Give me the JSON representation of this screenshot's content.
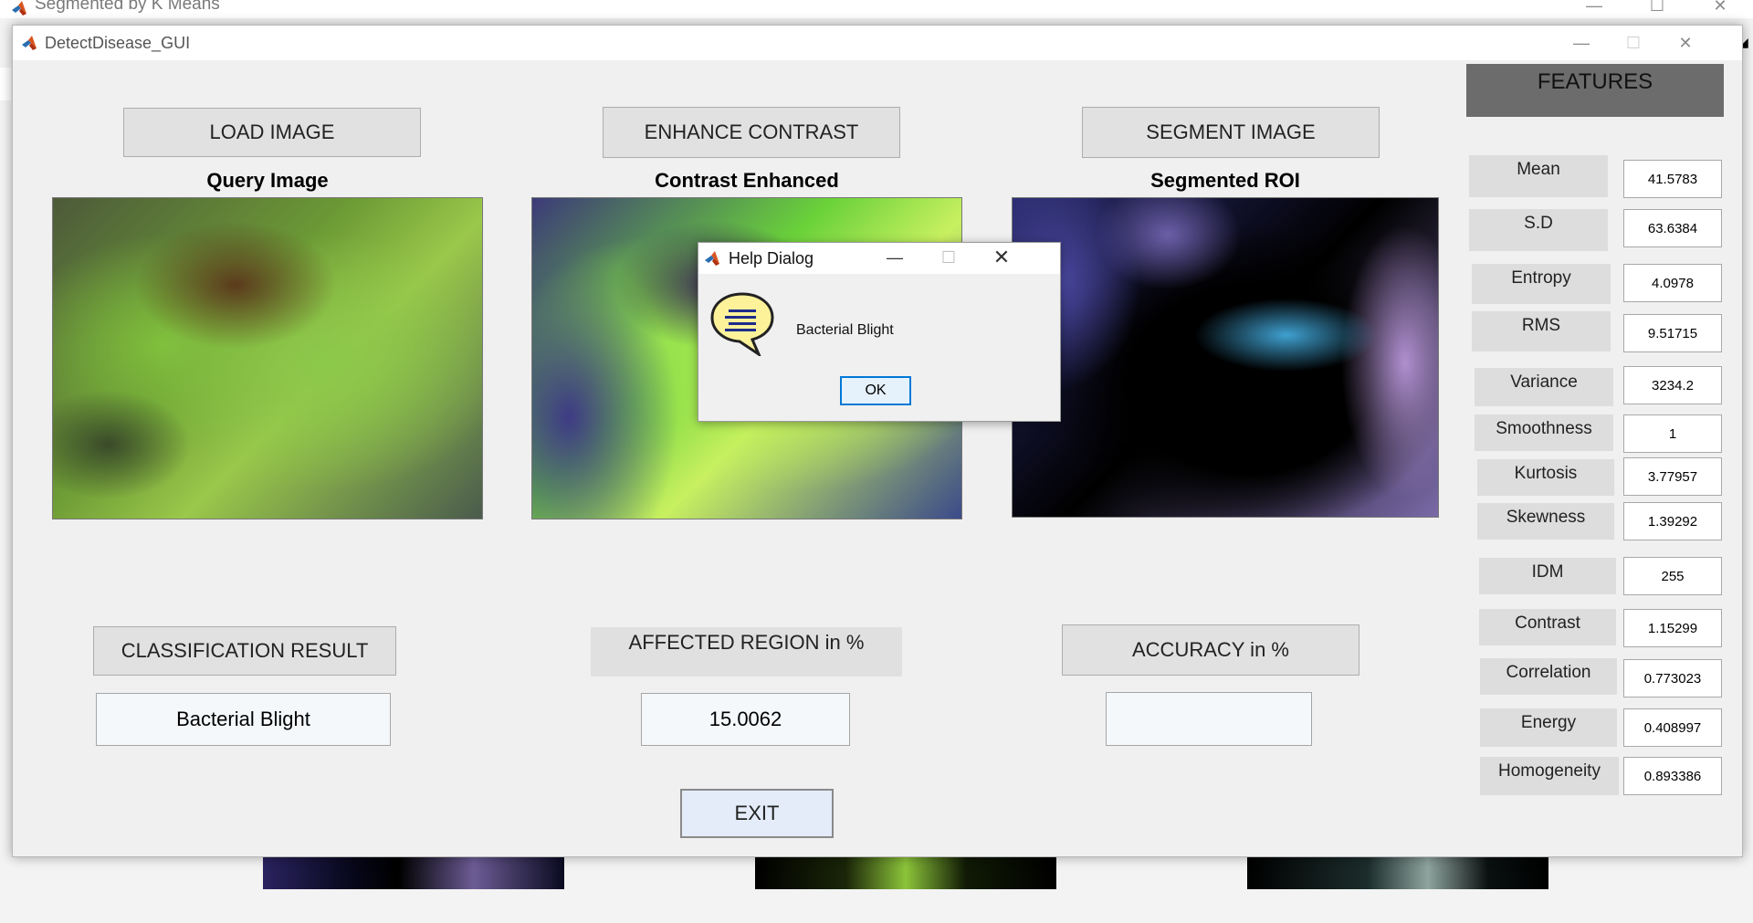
{
  "background_window": {
    "title": "Segmented by K Means"
  },
  "main_window": {
    "title": "DetectDisease_GUI"
  },
  "buttons": {
    "load_image": "LOAD IMAGE",
    "enhance_contrast": "ENHANCE CONTRAST",
    "segment_image": "SEGMENT IMAGE",
    "classification_result": "CLASSIFICATION RESULT",
    "affected_region": "AFFECTED REGION in %",
    "accuracy": "ACCURACY in %",
    "exit": "EXIT"
  },
  "captions": {
    "query_image": "Query Image",
    "contrast_enhanced": "Contrast Enhanced",
    "segmented_roi": "Segmented ROI"
  },
  "results": {
    "classification": "Bacterial Blight",
    "affected_region": "15.0062",
    "accuracy": ""
  },
  "features": {
    "header": "FEATURES",
    "items": [
      {
        "label": "Mean",
        "value": "41.5783"
      },
      {
        "label": "S.D",
        "value": "63.6384"
      },
      {
        "label": "Entropy",
        "value": "4.0978"
      },
      {
        "label": "RMS",
        "value": "9.51715"
      },
      {
        "label": "Variance",
        "value": "3234.2"
      },
      {
        "label": "Smoothness",
        "value": "1"
      },
      {
        "label": "Kurtosis",
        "value": "3.77957"
      },
      {
        "label": "Skewness",
        "value": "1.39292"
      },
      {
        "label": "IDM",
        "value": "255"
      },
      {
        "label": "Contrast",
        "value": "1.15299"
      },
      {
        "label": "Correlation",
        "value": "0.773023"
      },
      {
        "label": "Energy",
        "value": "0.408997"
      },
      {
        "label": "Homogeneity",
        "value": "0.893386"
      }
    ]
  },
  "help_dialog": {
    "title": "Help Dialog",
    "message": "Bacterial Blight",
    "ok_label": "OK"
  },
  "icons": {
    "app_icon": "matlab-logo-icon",
    "dialog_icon": "help-speech-bubble-icon"
  },
  "colors": {
    "button_bg": "#e1e1e1",
    "features_header_bg": "#6c6c6c",
    "ok_button_border": "#0078d7"
  }
}
